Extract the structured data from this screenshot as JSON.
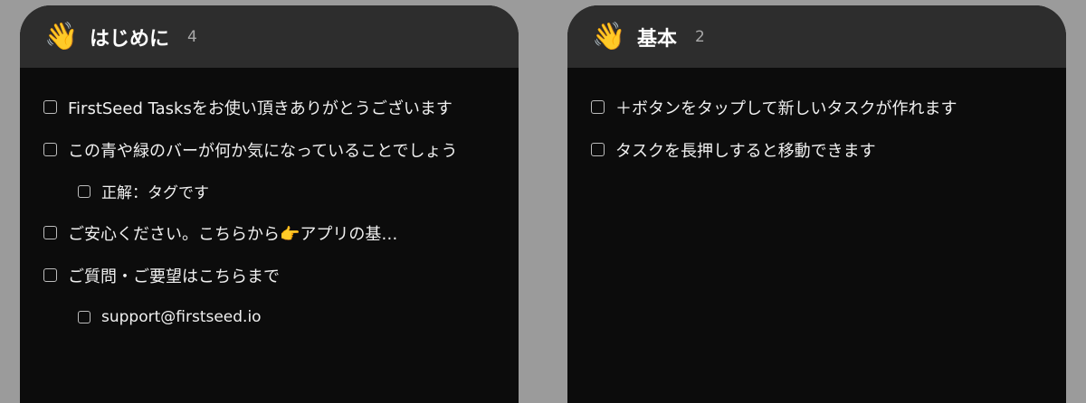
{
  "columns": [
    {
      "icon": "waving-hand-icon",
      "title": "はじめに",
      "count": "4",
      "tasks": [
        {
          "text": "FirstSeed Tasksをお使い頂きありがとうございます"
        },
        {
          "text": "この青や緑のバーが何か気になっていることでしょう"
        },
        {
          "text": "正解：タグです"
        },
        {
          "text": "ご安心ください。こちらから👉アプリの基…"
        },
        {
          "text": "ご質問・ご要望はこちらまで"
        },
        {
          "text": "support@firstseed.io"
        }
      ]
    },
    {
      "icon": "waving-hand-icon",
      "title": "基本",
      "count": "2",
      "tasks": [
        {
          "text": "＋ボタンをタップして新しいタスクが作れます"
        },
        {
          "text": "タスクを長押しすると移動できます"
        }
      ]
    }
  ]
}
